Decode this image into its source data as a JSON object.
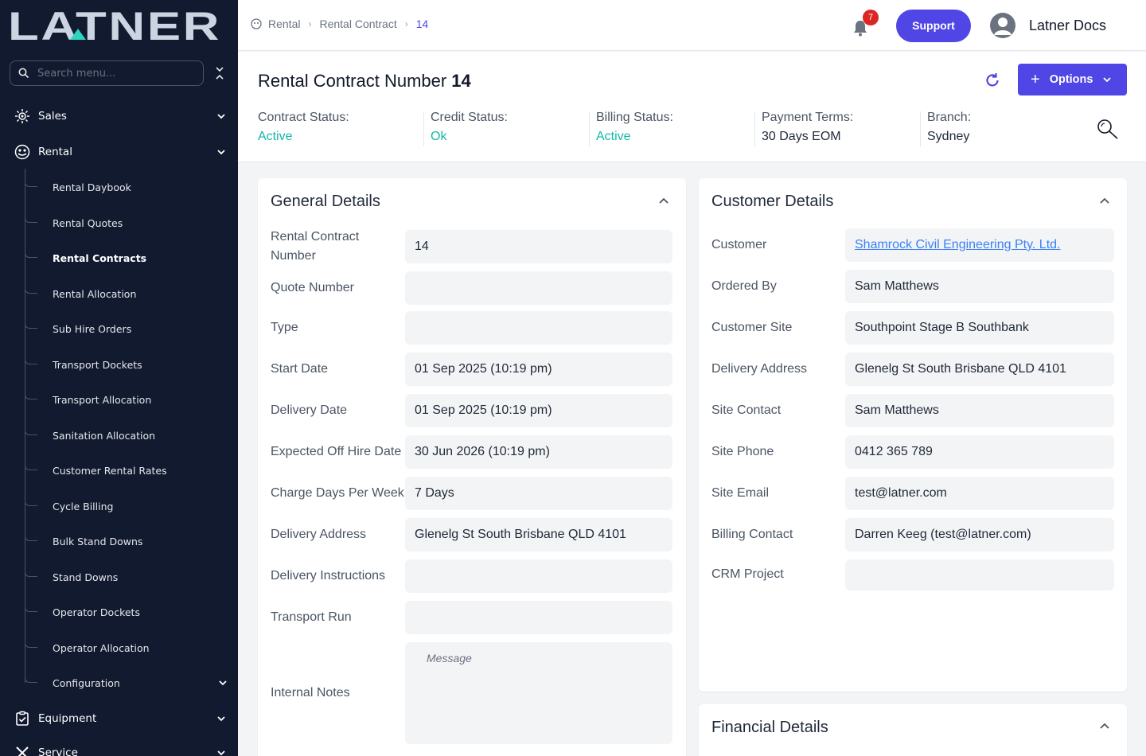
{
  "sidebar": {
    "logo": "LATNER",
    "search_placeholder": "Search menu...",
    "sales": "Sales",
    "rental": "Rental",
    "items": [
      "Rental Daybook",
      "Rental Quotes",
      "Rental Contracts",
      "Rental Allocation",
      "Sub Hire Orders",
      "Transport Dockets",
      "Transport Allocation",
      "Sanitation Allocation",
      "Customer Rental Rates",
      "Cycle Billing",
      "Bulk Stand Downs",
      "Stand Downs",
      "Operator Dockets",
      "Operator Allocation",
      "Configuration"
    ],
    "equipment": "Equipment",
    "service": "Service"
  },
  "header": {
    "breadcrumb": [
      "Rental",
      "Rental Contract",
      "14"
    ],
    "notification_count": "7",
    "support_label": "Support",
    "user_name": "Latner Docs"
  },
  "contract": {
    "title": "Rental Contract Number",
    "number": "14",
    "options_label": "Options",
    "contract_status_label": "Contract Status:",
    "contract_status": "Active",
    "credit_status_label": "Credit Status:",
    "credit_status": "Ok",
    "billing_status_label": "Billing Status:",
    "billing_status": "Active",
    "payment_terms_label": "Payment Terms:",
    "payment_terms": "30 Days EOM",
    "branch_label": "Branch:",
    "branch": "Sydney"
  },
  "general": {
    "title": "General Details",
    "rows": [
      {
        "label": "Rental Contract Number",
        "value": "14"
      },
      {
        "label": "Quote Number",
        "value": ""
      },
      {
        "label": "Type",
        "value": ""
      },
      {
        "label": "Start Date",
        "value": "01 Sep 2025 (10:19 pm)"
      },
      {
        "label": "Delivery Date",
        "value": "01 Sep 2025 (10:19 pm)"
      },
      {
        "label": "Expected Off Hire Date",
        "value": "30 Jun 2026 (10:19 pm)"
      },
      {
        "label": "Charge Days Per Week",
        "value": "7 Days"
      },
      {
        "label": "Delivery Address",
        "value": "Glenelg St South Brisbane QLD 4101"
      },
      {
        "label": "Delivery Instructions",
        "value": ""
      },
      {
        "label": "Transport Run",
        "value": ""
      }
    ],
    "internal_notes_label": "Internal Notes",
    "internal_notes_placeholder": "Message"
  },
  "customer": {
    "title": "Customer Details",
    "rows": [
      {
        "label": "Customer",
        "value": "Shamrock Civil Engineering Pty. Ltd."
      },
      {
        "label": "Ordered By",
        "value": "Sam Matthews"
      },
      {
        "label": "Customer Site",
        "value": "Southpoint Stage B Southbank"
      },
      {
        "label": "Delivery Address",
        "value": "Glenelg St South Brisbane QLD 4101"
      },
      {
        "label": "Site Contact",
        "value": "Sam Matthews"
      },
      {
        "label": "Site Phone",
        "value": "0412 365 789"
      },
      {
        "label": "Site Email",
        "value": "test@latner.com"
      },
      {
        "label": "Billing Contact",
        "value": "Darren Keeg (test@latner.com)"
      },
      {
        "label": "CRM Project",
        "value": ""
      }
    ]
  },
  "financial": {
    "title": "Financial Details"
  },
  "colors": {
    "accent": "#4f46e5",
    "sidebar_bg": "#111a2e",
    "status_active": "#14b8a6",
    "badge": "#dc2626",
    "link": "#3b82f6"
  }
}
